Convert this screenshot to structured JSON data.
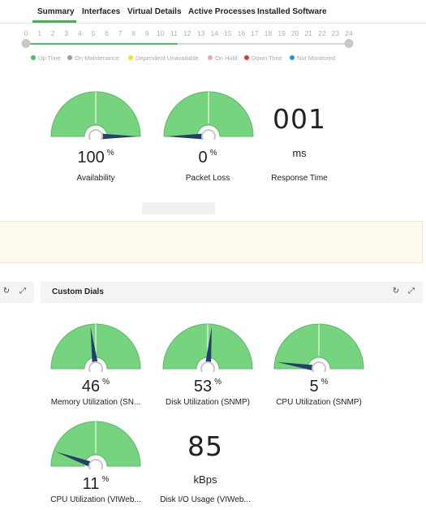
{
  "tabs": [
    {
      "label": "Summary",
      "active": true
    },
    {
      "label": "Interfaces",
      "active": false
    },
    {
      "label": "Virtual Details",
      "active": false
    },
    {
      "label": "Active Processes",
      "active": false
    },
    {
      "label": "Installed Software",
      "active": false
    }
  ],
  "timeline": {
    "hours": [
      "0",
      "1",
      "2",
      "3",
      "4",
      "5",
      "6",
      "7",
      "8",
      "9",
      "10",
      "11",
      "12",
      "13",
      "14",
      "15",
      "16",
      "17",
      "18",
      "19",
      "20",
      "21",
      "22",
      "23",
      "24"
    ]
  },
  "legend": [
    {
      "label": "Up Time",
      "color": "#4cc05a"
    },
    {
      "label": "On Maintenance",
      "color": "#9e9e9e"
    },
    {
      "label": "Dependent Unavailable",
      "color": "#f2e230"
    },
    {
      "label": "On Hold",
      "color": "#f4a7a7"
    },
    {
      "label": "Down Time",
      "color": "#e03a3a"
    },
    {
      "label": "Not Monitored",
      "color": "#2f8fe0"
    }
  ],
  "summary": {
    "availability": {
      "value": "100",
      "unit": "%",
      "label": "Availability",
      "level": 100
    },
    "packet_loss": {
      "value": "0",
      "unit": "%",
      "label": "Packet Loss",
      "level": 0
    },
    "response_time": {
      "value": "001",
      "unit": "ms",
      "label": "Response Time"
    }
  },
  "custom_dials": {
    "title": "Custom Dials",
    "memory": {
      "value": "46",
      "unit": "%",
      "label": "Memory Utilization (SN...",
      "level": 46
    },
    "disk": {
      "value": "53",
      "unit": "%",
      "label": "Disk Utilization (SNMP)",
      "level": 53
    },
    "cpu_snmp": {
      "value": "5",
      "unit": "%",
      "label": "CPU Utilization (SNMP)",
      "level": 5
    },
    "cpu_vmware": {
      "value": "11",
      "unit": "%",
      "label": "CPU Utilization (VIWeb...",
      "level": 11
    },
    "disk_io": {
      "value": "85",
      "unit": "kBps",
      "label": "Disk I/O Usage (VIWeb..."
    }
  },
  "colors": {
    "gauge_fill": "#76d37e",
    "gauge_stroke": "#5cb866",
    "needle": "#233f6b",
    "accent": "#3cb54a"
  }
}
